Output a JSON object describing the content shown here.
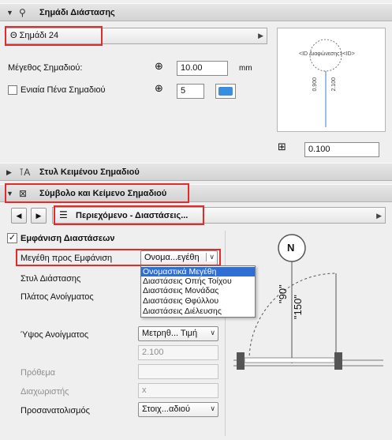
{
  "section1": {
    "title": "Σημάδι Διάστασης"
  },
  "marker_type": {
    "value": "Θ Σημάδι 24"
  },
  "marker_size": {
    "label": "Μέγεθος Σημαδιού:",
    "value": "10.00",
    "unit": "mm"
  },
  "uniform_pen": {
    "label": "Ενιαία Πένα Σημαδιού",
    "pen_value": "5"
  },
  "preview": {
    "id_text": "<ID Διαφώνεσης><ID>",
    "dim1": "0.900",
    "dim2": "2.100"
  },
  "preview_scale": {
    "value": "0.100"
  },
  "section2": {
    "title": "Στυλ Κειμένου Σημαδιού"
  },
  "section3": {
    "title": "Σύμβολο και Κείμενο Σημαδιού"
  },
  "subpanel": {
    "title": "Περιεχόμενο - Διαστάσεις..."
  },
  "show_dims": {
    "label": "Εμφάνιση Διαστάσεων"
  },
  "dims_to_show": {
    "label": "Μεγέθη προς Εμφάνιση",
    "value": "Ονομα...εγέθη"
  },
  "dropdown": {
    "options": [
      "Ονομαστικά Μεγέθη",
      "Διαστάσεις Οπής Τοίχου",
      "Διαστάσεις Μονάδας",
      "Διαστάσεις Θφύλλου",
      "Διαστάσεις Διέλευσης"
    ],
    "selected_index": 0
  },
  "rows": {
    "dim_style": "Στυλ Διάστασης",
    "opening_width": "Πλάτος Ανοίγματος",
    "opening_height": "Ύψος Ανοίγματος",
    "opening_height_sel": "Μετρηθ... Τιμή",
    "opening_height_val": "2.100",
    "prefix": "Πρόθεμα",
    "separator": "Διαχωριστής",
    "separator_val": "x",
    "orientation": "Προσανατολισμός",
    "orientation_sel": "Στοιχ...αδιού"
  },
  "diagram": {
    "north": "N",
    "dim_a": "\"90\"",
    "dim_b": "\"150\""
  }
}
